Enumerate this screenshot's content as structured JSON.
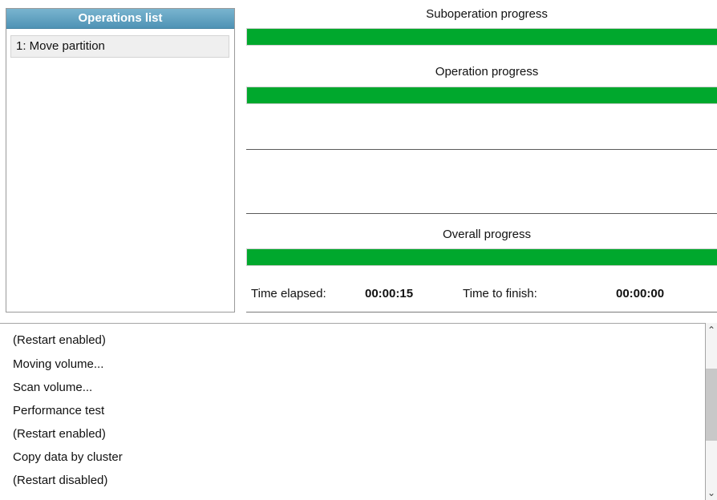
{
  "operations": {
    "header": "Operations list",
    "items": [
      {
        "label": "1: Move partition"
      }
    ]
  },
  "progress": {
    "suboperation": {
      "label": "Suboperation progress",
      "value": 1.0
    },
    "operation": {
      "label": "Operation progress",
      "value": 1.0
    },
    "overall": {
      "label": "Overall progress",
      "value": 1.0
    },
    "bar_color": "#00a82d"
  },
  "time": {
    "elapsed_label": "Time elapsed:",
    "elapsed_value": "00:00:15",
    "finish_label": "Time to finish:",
    "finish_value": "00:00:00"
  },
  "log": {
    "lines": [
      "(Restart enabled)",
      "Moving volume...",
      "Scan volume...",
      "Performance test",
      "(Restart enabled)",
      "Copy data by cluster",
      "(Restart disabled)"
    ]
  },
  "scrollbar": {
    "up_icon": "chevron-up-icon",
    "down_icon": "chevron-down-icon"
  }
}
